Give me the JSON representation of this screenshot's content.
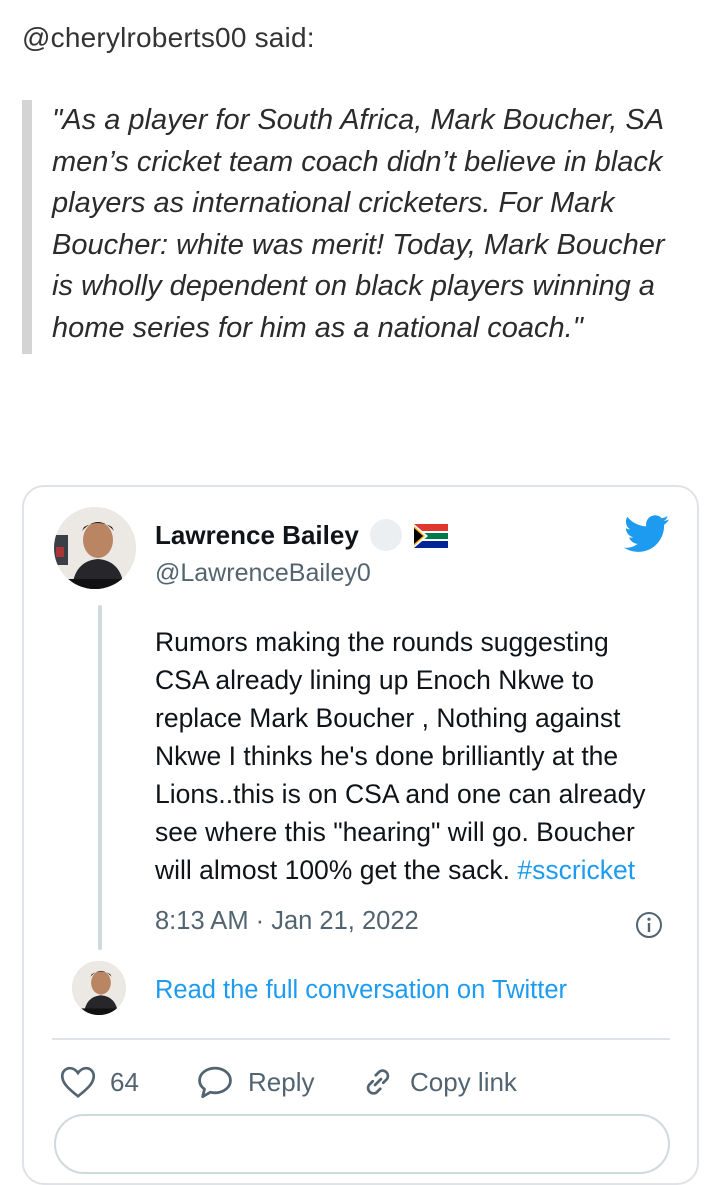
{
  "post": {
    "attribution": "@cherylroberts00 said:",
    "quote_lines": [
      "\"As a player for South Africa, Mark Boucher, SA",
      "men’s cricket team coach didn’t believe in black",
      "players as international cricketers. For Mark",
      "Boucher: white was merit! Today, Mark Boucher",
      "is wholly dependent on black players winning a",
      "home series for him as a national coach.\""
    ]
  },
  "tweet": {
    "author_name": "Lawrence Bailey",
    "author_handle": "@LawrenceBailey0",
    "text_lines": [
      "Rumors making the rounds suggesting",
      "CSA already lining up Enoch Nkwe to",
      "replace Mark Boucher , Nothing against",
      "Nkwe I thinks he's done brilliantly at the",
      "Lions..this is on CSA and one can already",
      "see where this \"hearing\" will go. Boucher"
    ],
    "last_line_text": "will almost 100% get the sack. ",
    "hashtag": "#sscricket",
    "timestamp": "8:13 AM · Jan 21, 2022",
    "read_full_link": "Read the full conversation on Twitter",
    "like_count": "64",
    "reply_label": "Reply",
    "copy_link_label": "Copy link",
    "colors": {
      "accent": "#1d9bf0",
      "secondary_text": "#536471",
      "primary_text": "#0f1419"
    },
    "icons": [
      "twitter-bird-icon",
      "south-africa-flag-icon",
      "info-icon",
      "heart-icon",
      "reply-bubble-icon",
      "link-icon"
    ]
  }
}
